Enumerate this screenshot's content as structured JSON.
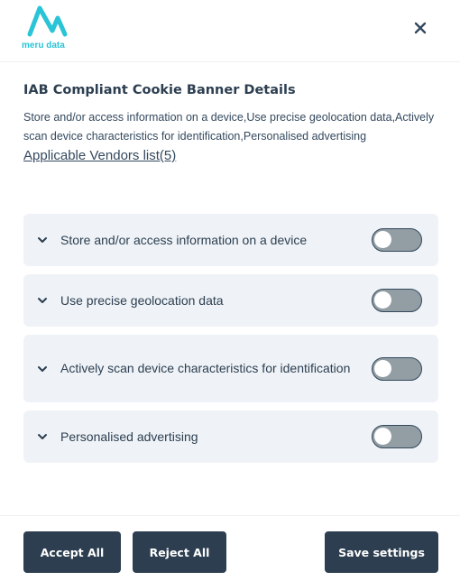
{
  "header": {
    "logo_text": "meru data",
    "close_icon": "close-icon"
  },
  "colors": {
    "brand": "#29c4d6",
    "primary": "#2c3e50",
    "item_bg": "#eff3f7",
    "toggle_off": "#929da4"
  },
  "content": {
    "title": "IAB Compliant Cookie Banner Details",
    "description": "Store and/or access information on a device,Use precise geolocation data,Actively scan device characteristics for identification,Personalised advertising",
    "vendors_link": "Applicable Vendors list(5)"
  },
  "purposes": [
    {
      "label": "Store and/or access information on a device",
      "enabled": false
    },
    {
      "label": "Use precise geolocation data",
      "enabled": false
    },
    {
      "label": "Actively scan device characteristics for identification",
      "enabled": false
    },
    {
      "label": "Personalised advertising",
      "enabled": false
    }
  ],
  "footer": {
    "accept_all": "Accept All",
    "reject_all": "Reject All",
    "save_settings": "Save settings"
  }
}
